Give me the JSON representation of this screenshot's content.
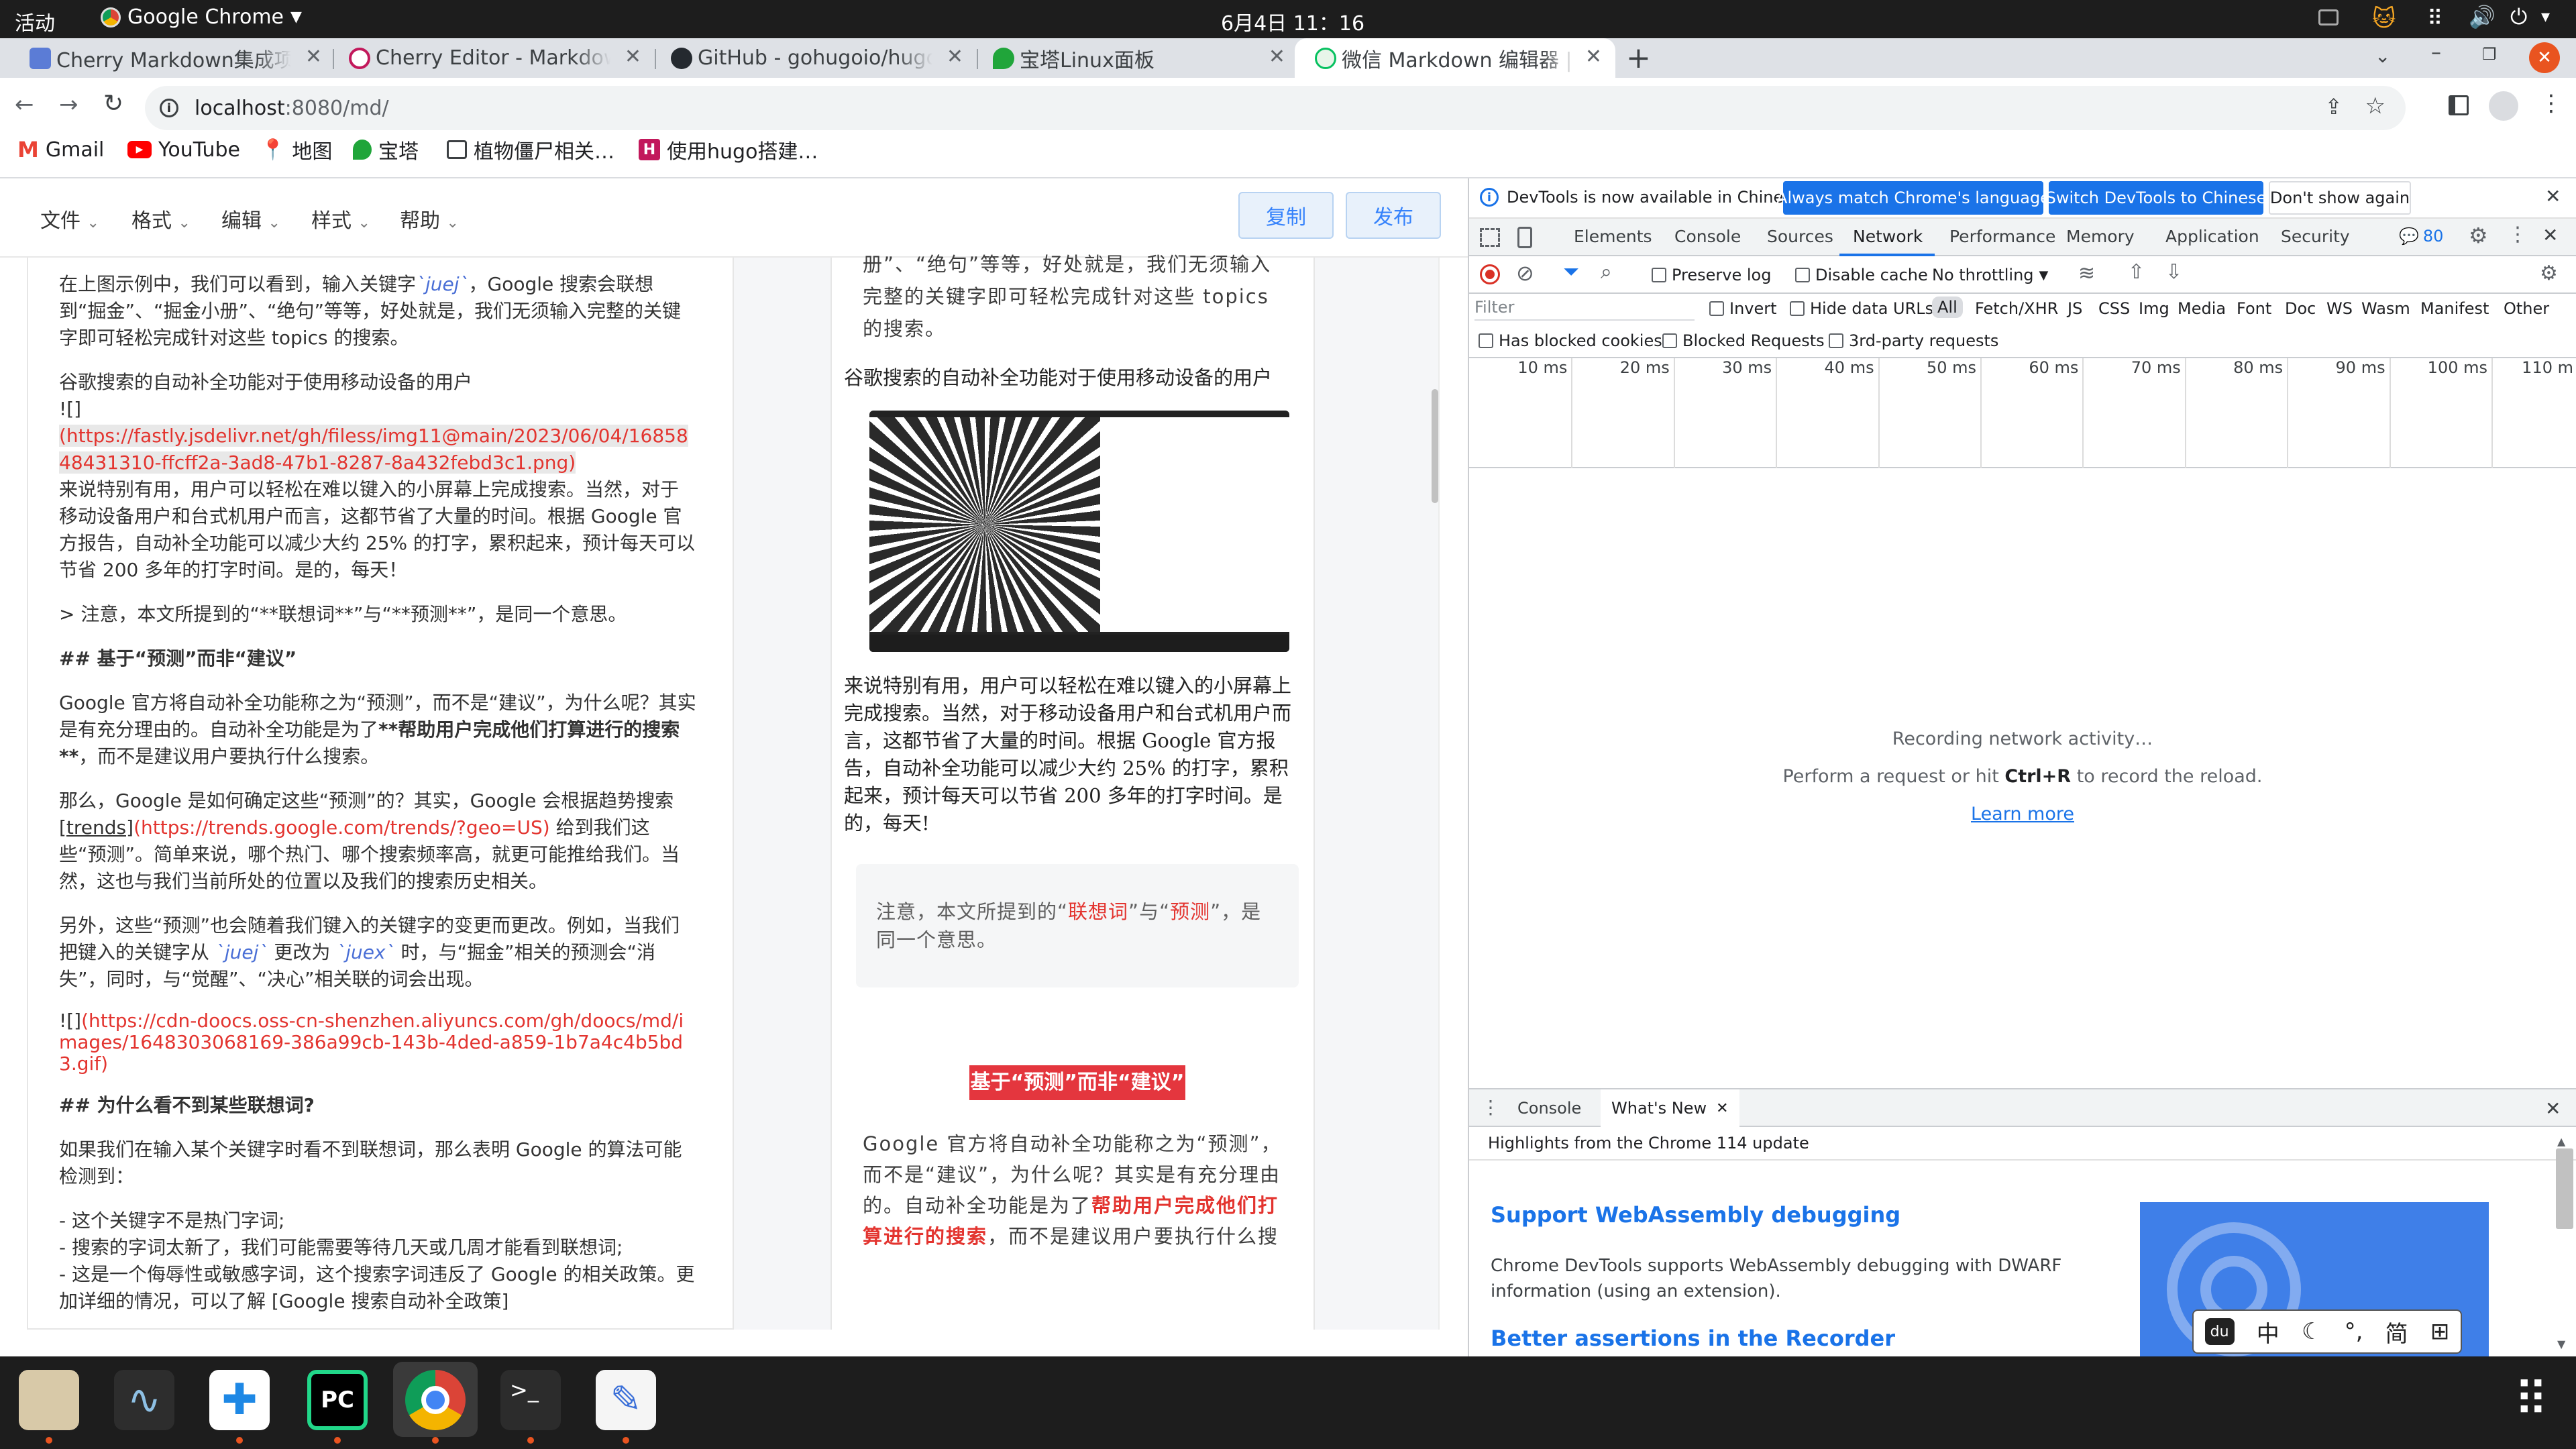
{
  "system": {
    "activities": "活动",
    "app_name": "Google Chrome",
    "clock": "6月4日  11：16"
  },
  "tabs": [
    {
      "title": "Cherry Markdown集成项目"
    },
    {
      "title": "Cherry Editor - Markdown"
    },
    {
      "title": "GitHub - gohugoio/hugo:"
    },
    {
      "title": "宝塔Linux面板"
    },
    {
      "title": "微信 Markdown 编辑器 | D"
    }
  ],
  "address": {
    "url_host": "localhost",
    "url_path": ":8080/md/"
  },
  "bookmarks": [
    "Gmail",
    "YouTube",
    "地图",
    "宝塔",
    "植物僵尸相关…",
    "使用hugo搭建…"
  ],
  "editor_menu": {
    "items": [
      "文件",
      "格式",
      "编辑",
      "样式",
      "帮助"
    ],
    "copy_label": "复制",
    "publish_label": "发布"
  },
  "editor": {
    "p1": "在上图示例中，我们可以看到，输入关键字",
    "p1_code": "`juej`",
    "p1b": "，Google 搜索会联想到“掘金”、“掘金小册”、“绝句”等等，好处就是，我们无须输入完整的关键字即可轻松完成针对这些 topics 的搜索。",
    "p2": "谷歌搜索的自动补全功能对于使用移动设备的用户",
    "p2_img": "![]",
    "p2_link": "(https://fastly.jsdelivr.net/gh/filess/img11@main/2023/06/04/1685848431310-ffcff2a-3ad8-47b1-8287-8a432febd3c1.png)",
    "p3": "来说特别有用，用户可以轻松在难以键入的小屏幕上完成搜索。当然，对于移动设备用户和台式机用户而言，这都节省了大量的时间。根据 Google 官方报告，自动补全功能可以减少大约 25% 的打字，累积起来，预计每天可以节省 200 多年的打字时间。是的，每天！",
    "p4": "> 注意，本文所提到的“**联想词**”与“**预测**”，是同一个意思。",
    "h1": "## 基于“预测”而非“建议”",
    "p5a": "Google 官方将自动补全功能称之为“预测”，而不是“建议”，为什么呢？其实是有充分理由的。自动补全功能是为了",
    "p5b": "**帮助用户完成他们打算进行的搜索**",
    "p5c": "，而不是建议用户要执行什么搜索。",
    "p6a": "那么，Google 是如何确定这些“预测”的？其实，Google 会根据趋势搜索",
    "p6b": "[trends]",
    "p6c": "(https://trends.google.com/trends/?geo=US)",
    "p6d": " 给到我们这些“预测”。简单来说，哪个热门、哪个搜索频率高，就更可能推给我们。当然，这也与我们当前所处的位置以及我们的搜索历史相关。",
    "p7a": "另外，这些“预测”也会随着我们键入的关键字的变更而更改。例如，当我们把键入的关键字从 ",
    "p7b": "`juej`",
    "p7c": " 更改为 ",
    "p7d": "`juex`",
    "p7e": " 时，与“掘金”相关的预测会“消失”，同时，与“觉醒”、“决心”相关联的词会出现。",
    "p8a": "![]",
    "p8b": "(https://cdn-doocs.oss-cn-shenzhen.aliyuncs.com/gh/doocs/md/images/1648303068169-386a99cb-143b-4ded-a859-1b7a4c4b5bd3.gif)",
    "h2": "## 为什么看不到某些联想词?",
    "p9": "如果我们在输入某个关键字时看不到联想词，那么表明 Google 的算法可能检测到：",
    "li1": "- 这个关键字不是热门字词;",
    "li2": "- 搜索的字词太新了，我们可能需要等待几天或几周才能看到联想词;",
    "li3": "- 这是一个侮辱性或敏感字词，这个搜索字词违反了 Google 的相关政策。更加详细的情况，可以了解 [Google 搜索自动补全政策]"
  },
  "preview": {
    "p0": "册”、“绝句”等等，好处就是，我们无须输入完整的关键字即可轻松完成针对这些 topics 的搜索。",
    "p1": "谷歌搜索的自动补全功能对于使用移动设备的用户",
    "p2": "来说特别有用，用户可以轻松在难以键入的小屏幕上完成搜索。当然，对于移动设备用户和台式机用户而言，这都节省了大量的时间。根据 Google 官方报告，自动补全功能可以减少大约 25% 的打字，累积起来，预计每天可以节省 200 多年的打字时间。是的，每天!",
    "quote_a": "注意，本文所提到的“",
    "quote_b": "联想词",
    "quote_c": "”与“",
    "quote_d": "预测",
    "quote_e": "”，是同一个意思。",
    "heading": "基于“预测”而非“建议”",
    "p3a": "Google 官方将自动补全功能称之为“预测”，而不是“建议”，为什么呢？其实是有充分理由的。自动补全功能是为了",
    "p3b": "帮助用户完成他们打算进行的搜索",
    "p3c": "，而不是建议用户要执行什么搜"
  },
  "devtools": {
    "info_text": "DevTools is now available in Chinese!",
    "btn_match": "Always match Chrome's language",
    "btn_switch": "Switch DevTools to Chinese",
    "btn_dont": "Don't show again",
    "tabs": [
      "Elements",
      "Console",
      "Sources",
      "Network",
      "Performance",
      "Memory",
      "Application",
      "Security"
    ],
    "issues_count": "80",
    "preserve_log": "Preserve log",
    "disable_cache": "Disable cache",
    "throttling": "No throttling",
    "filter_placeholder": "Filter",
    "invert": "Invert",
    "hide_data_urls": "Hide data URLs",
    "types": [
      "All",
      "Fetch/XHR",
      "JS",
      "CSS",
      "Img",
      "Media",
      "Font",
      "Doc",
      "WS",
      "Wasm",
      "Manifest",
      "Other"
    ],
    "has_blocked": "Has blocked cookies",
    "blocked_requests": "Blocked Requests",
    "third_party": "3rd-party requests",
    "ticks": [
      "10 ms",
      "20 ms",
      "30 ms",
      "40 ms",
      "50 ms",
      "60 ms",
      "70 ms",
      "80 ms",
      "90 ms",
      "100 ms",
      "110 m"
    ],
    "recording": "Recording network activity…",
    "perform_a": "Perform a request or hit ",
    "perform_key": "Ctrl+R",
    "perform_b": " to record the reload.",
    "learn_more": "Learn more",
    "drawer_console": "Console",
    "drawer_whatsnew": "What's New",
    "highlights": "Highlights from the Chrome 114 update",
    "wn_title1": "Support WebAssembly debugging",
    "wn_desc1": "Chrome DevTools supports WebAssembly debugging with DWARF information (using an extension).",
    "wn_title2": "Better assertions in the Recorder"
  },
  "ime": {
    "zh": "中",
    "moon": "☾",
    "punct": "°,",
    "jian": "简",
    "grid": "⊞"
  }
}
